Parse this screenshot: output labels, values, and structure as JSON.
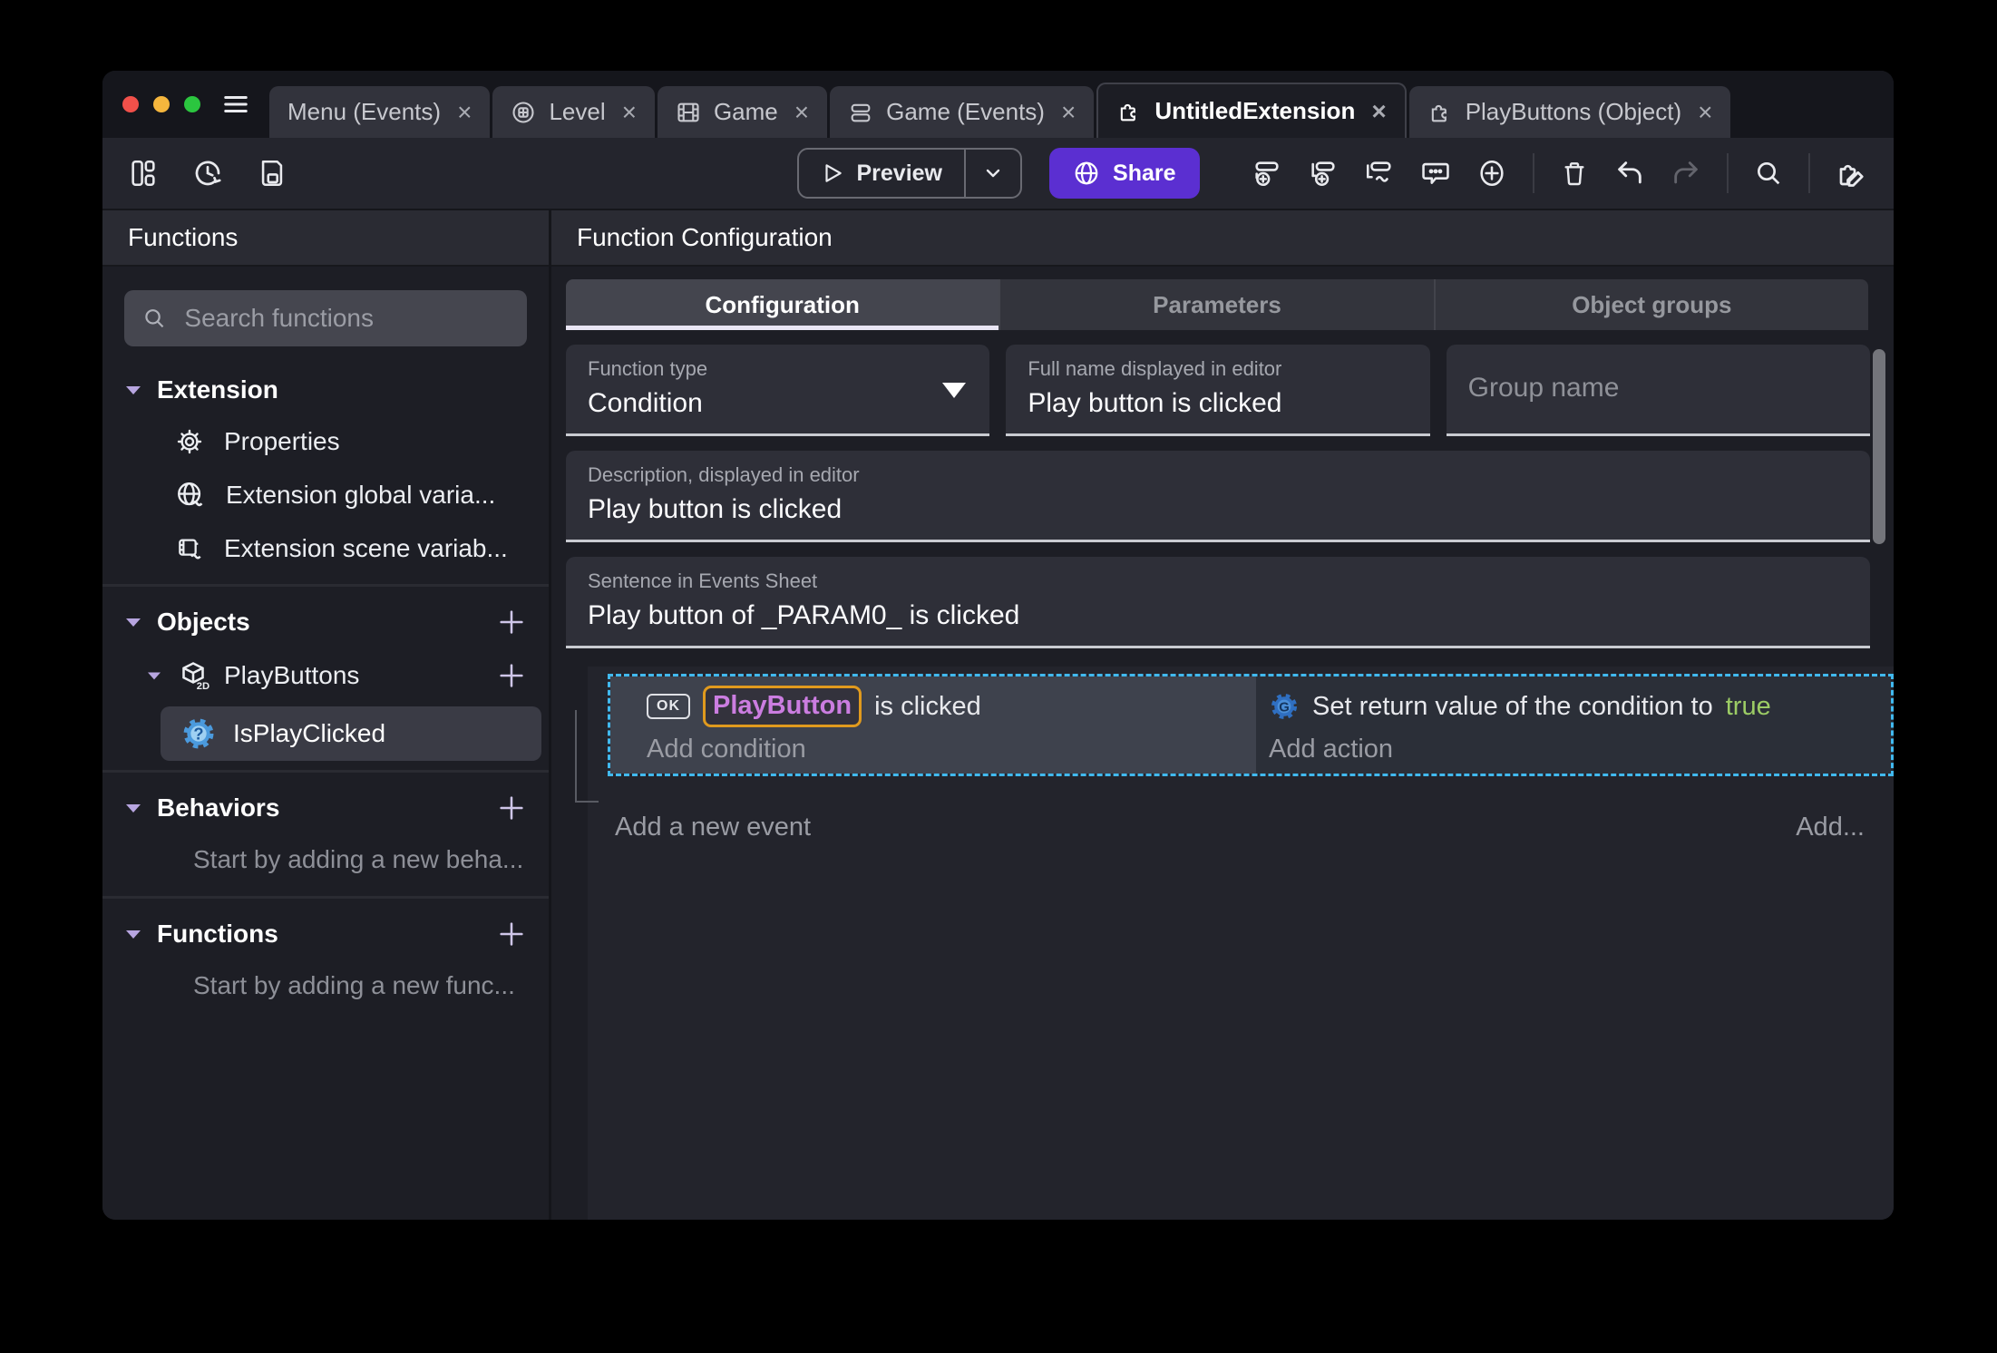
{
  "icons": {
    "close": "×"
  },
  "tab_bar": {
    "tabs": [
      {
        "label": "Menu (Events)",
        "icon": "none",
        "active": false
      },
      {
        "label": "Level",
        "icon": "scene-icon",
        "active": false
      },
      {
        "label": "Game",
        "icon": "film-icon",
        "active": false
      },
      {
        "label": "Game (Events)",
        "icon": "events-icon",
        "active": false
      },
      {
        "label": "UntitledExtension",
        "icon": "puzzle-icon",
        "active": true
      },
      {
        "label": "PlayButtons (Object)",
        "icon": "puzzle-icon",
        "active": false
      }
    ]
  },
  "toolbar": {
    "preview_label": "Preview",
    "share_label": "Share"
  },
  "sidebar": {
    "title": "Functions",
    "search_placeholder": "Search functions",
    "extension_section": {
      "label": "Extension",
      "items": [
        {
          "label": "Properties",
          "icon": "gear-icon"
        },
        {
          "label": "Extension global varia...",
          "icon": "globe-variable-icon"
        },
        {
          "label": "Extension scene variab...",
          "icon": "scene-variable-icon"
        }
      ]
    },
    "objects_section": {
      "label": "Objects",
      "object_label": "PlayButtons",
      "function_label": "IsPlayClicked"
    },
    "behaviors_section": {
      "label": "Behaviors",
      "hint": "Start by adding a new beha..."
    },
    "functions_section": {
      "label": "Functions",
      "hint": "Start by adding a new func..."
    }
  },
  "main": {
    "title": "Function Configuration",
    "tabs": [
      {
        "label": "Configuration",
        "active": true
      },
      {
        "label": "Parameters",
        "active": false
      },
      {
        "label": "Object groups",
        "active": false
      }
    ],
    "form": {
      "function_type": {
        "label": "Function type",
        "value": "Condition"
      },
      "full_name": {
        "label": "Full name displayed in editor",
        "value": "Play button is clicked"
      },
      "group_name": {
        "placeholder": "Group name"
      },
      "description": {
        "label": "Description, displayed in editor",
        "value": "Play button is clicked"
      },
      "sentence": {
        "label": "Sentence in Events Sheet",
        "value": "Play button of _PARAM0_ is clicked"
      }
    },
    "events_sheet": {
      "event": {
        "condition": {
          "badge": "OK",
          "object_name": "PlayButton",
          "text": "is clicked",
          "add_label": "Add condition"
        },
        "action": {
          "text_before": "Set return value of the condition to",
          "value": "true",
          "add_label": "Add action"
        }
      },
      "add_new_event_label": "Add a new event",
      "add_button_label": "Add..."
    }
  },
  "colors": {
    "accent_purple": "#5b2fd1",
    "selection_blue": "#41b9ef",
    "object_chip_text": "#cb7de0",
    "object_chip_border": "#e09a1e",
    "true_green": "#9ccc65"
  }
}
